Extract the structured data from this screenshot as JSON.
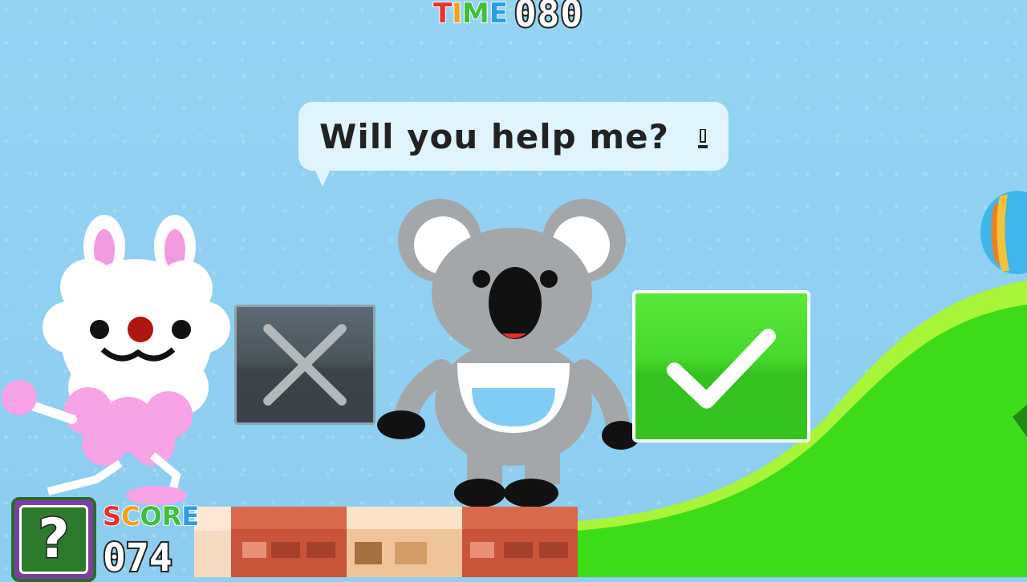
{
  "hud": {
    "time_label_letters": [
      "T",
      "I",
      "M",
      "E"
    ],
    "time_label_colors": [
      "#e8302a",
      "#f2a01c",
      "#3fbf3f",
      "#2a9de8"
    ],
    "time_value": "080",
    "score_label_letters": [
      "S",
      "C",
      "O",
      "R",
      "E"
    ],
    "score_label_colors": [
      "#e8302a",
      "#f2a01c",
      "#3fbf3f",
      "#3fbf3f",
      "#2a9de8"
    ],
    "score_value": "074",
    "item_box_icon": "question-mark-icon",
    "item_box_text": "?"
  },
  "dialog": {
    "text": "Will you help me?",
    "advance_icon": "next-arrow-icon"
  },
  "choices": {
    "no_icon": "x-mark-icon",
    "yes_icon": "checkmark-icon",
    "no_color": "#46525a",
    "yes_color": "#3fd226"
  },
  "characters": [
    "koala",
    "white-bunny"
  ],
  "colors": {
    "sky": "#8fd0f2",
    "grass": "#3ddc18",
    "grass_highlight": "#a8f53a",
    "bubble": "#dff4fc"
  }
}
